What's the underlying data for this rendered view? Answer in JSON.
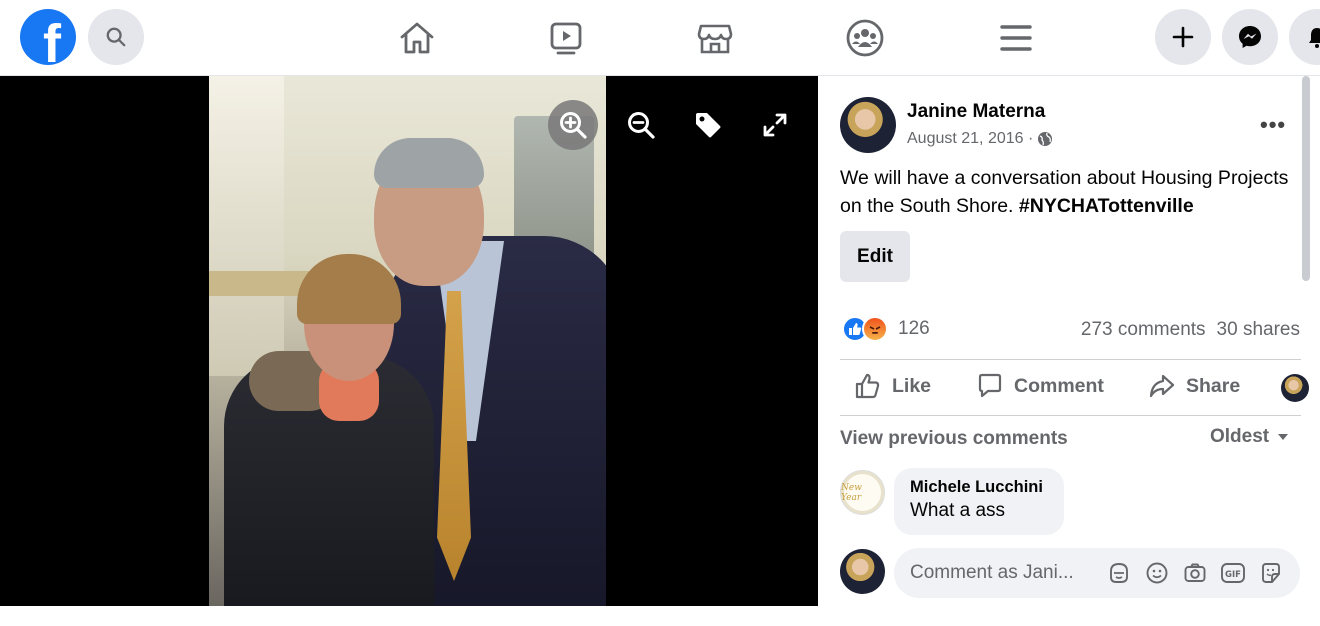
{
  "topbar": {
    "logo": "f",
    "icons": [
      "search-icon",
      "home-icon",
      "watch-icon",
      "marketplace-icon",
      "groups-icon",
      "menu-icon",
      "create-icon",
      "messenger-icon",
      "notifications-icon"
    ]
  },
  "viewer": {
    "controls": [
      "zoom-in-icon",
      "zoom-out-icon",
      "tag-icon",
      "fullscreen-icon"
    ]
  },
  "post": {
    "author": "Janine Materna",
    "date": "August 21, 2016 ·",
    "privacy_icon": "globe-icon",
    "text": "We will have a conversation about Housing Projects on the South Shore.",
    "hashtag": "#NYCHATottenville",
    "edit_label": "Edit",
    "reactions": {
      "types": [
        "like",
        "angry"
      ],
      "count": "126"
    },
    "comments_count": "273 comments",
    "shares_count": "30 shares",
    "actions": {
      "like": "Like",
      "comment": "Comment",
      "share": "Share"
    }
  },
  "comments": {
    "view_previous": "View previous comments",
    "sort": "Oldest",
    "items": [
      {
        "name": "Michele Lucchini",
        "text": "What a ass",
        "avatar_text": "New Year"
      }
    ],
    "input_placeholder": "Comment as Jani..."
  },
  "colors": {
    "brand": "#1877f2",
    "angry": "#f0521c",
    "muted": "#65676b"
  }
}
